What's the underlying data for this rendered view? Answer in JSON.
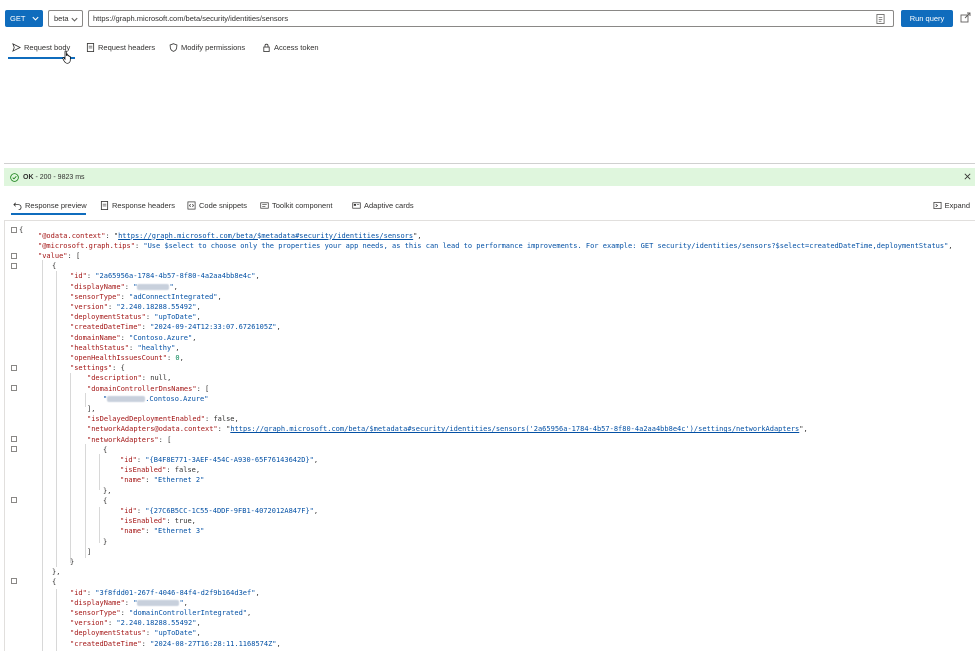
{
  "toolbar": {
    "method": "GET",
    "version": "beta",
    "url": "https://graph.microsoft.com/beta/security/identities/sensors",
    "run_label": "Run query"
  },
  "request_tabs": [
    {
      "label": "Request body",
      "icon": "send-icon",
      "active": true
    },
    {
      "label": "Request headers",
      "icon": "document-icon"
    },
    {
      "label": "Modify permissions",
      "icon": "shield-icon"
    },
    {
      "label": "Access token",
      "icon": "lock-icon"
    }
  ],
  "status": {
    "ok": "OK",
    "detail": "- 200 - 9823 ms"
  },
  "response_tabs": [
    {
      "label": "Response preview",
      "icon": "undo-icon",
      "active": true
    },
    {
      "label": "Response headers",
      "icon": "document-icon"
    },
    {
      "label": "Code snippets",
      "icon": "code-icon"
    },
    {
      "label": "Toolkit component",
      "icon": "toolkit-icon"
    },
    {
      "label": "Adaptive cards",
      "icon": "card-icon"
    }
  ],
  "expand_label": "Expand",
  "response": {
    "odata_context_key": "\"@odata.context\"",
    "odata_context_value": "https://graph.microsoft.com/beta/$metadata#security/identities/sensors",
    "tips_key": "\"@microsoft.graph.tips\"",
    "tips_value": "\"Use $select to choose only the properties your app needs, as this can lead to performance improvements. For example: GET security/identities/sensors?$select=createdDateTime,deploymentStatus\"",
    "value_key": "\"value\"",
    "items": [
      {
        "id": "\"2a65956a-1784-4b57-8f80-4a2aa4bb8e4c\"",
        "sensorType": "\"adConnectIntegrated\"",
        "version": "\"2.240.18288.55492\"",
        "deploymentStatus": "\"upToDate\"",
        "createdDateTime": "\"2024-09-24T12:33:07.6726105Z\"",
        "domainName": "\"Contoso.Azure\"",
        "healthStatus": "\"healthy\"",
        "openHealthIssuesCount": "0",
        "settings": {
          "description": "null",
          "dc_suffix": ".Contoso.Azure\"",
          "isDelayedDeploymentEnabled": "false",
          "adapters_context": "https://graph.microsoft.com/beta/$metadata#security/identities/sensors('2a65956a-1784-4b57-8f80-4a2aa4bb8e4c')/settings/networkAdapters",
          "adapters": [
            {
              "id": "\"{B4F8E771-3AEF-454C-A930-65F76143642D}\"",
              "isEnabled": "false",
              "name": "\"Ethernet 2\""
            },
            {
              "id": "\"{27C6B5CC-1C55-4DDF-9FB1-4072012A847F}\"",
              "isEnabled": "true",
              "name": "\"Ethernet 3\""
            }
          ]
        }
      },
      {
        "id": "\"3f8fdd01-267f-4046-84f4-d2f9b164d3ef\"",
        "sensorType": "\"domainControllerIntegrated\"",
        "version": "\"2.240.18288.55492\"",
        "deploymentStatus": "\"upToDate\"",
        "createdDateTime": "\"2024-08-27T16:28:11.1168574Z\""
      }
    ]
  },
  "keys": {
    "id": "\"id\"",
    "displayName": "\"displayName\"",
    "sensorType": "\"sensorType\"",
    "version": "\"version\"",
    "deploymentStatus": "\"deploymentStatus\"",
    "createdDateTime": "\"createdDateTime\"",
    "domainName": "\"domainName\"",
    "healthStatus": "\"healthStatus\"",
    "openHealthIssuesCount": "\"openHealthIssuesCount\"",
    "settings": "\"settings\"",
    "description": "\"description\"",
    "domainControllerDnsNames": "\"domainControllerDnsNames\"",
    "isDelayedDeploymentEnabled": "\"isDelayedDeploymentEnabled\"",
    "networkAdaptersContext": "\"networkAdapters@odata.context\"",
    "networkAdapters": "\"networkAdapters\"",
    "isEnabled": "\"isEnabled\"",
    "name": "\"name\""
  },
  "colors": {
    "accent": "#0f6cbd",
    "status_bg": "#dff6dd",
    "status_icon": "#107c10",
    "json_key": "#a31515",
    "json_string": "#0451a5",
    "json_number": "#098658"
  }
}
